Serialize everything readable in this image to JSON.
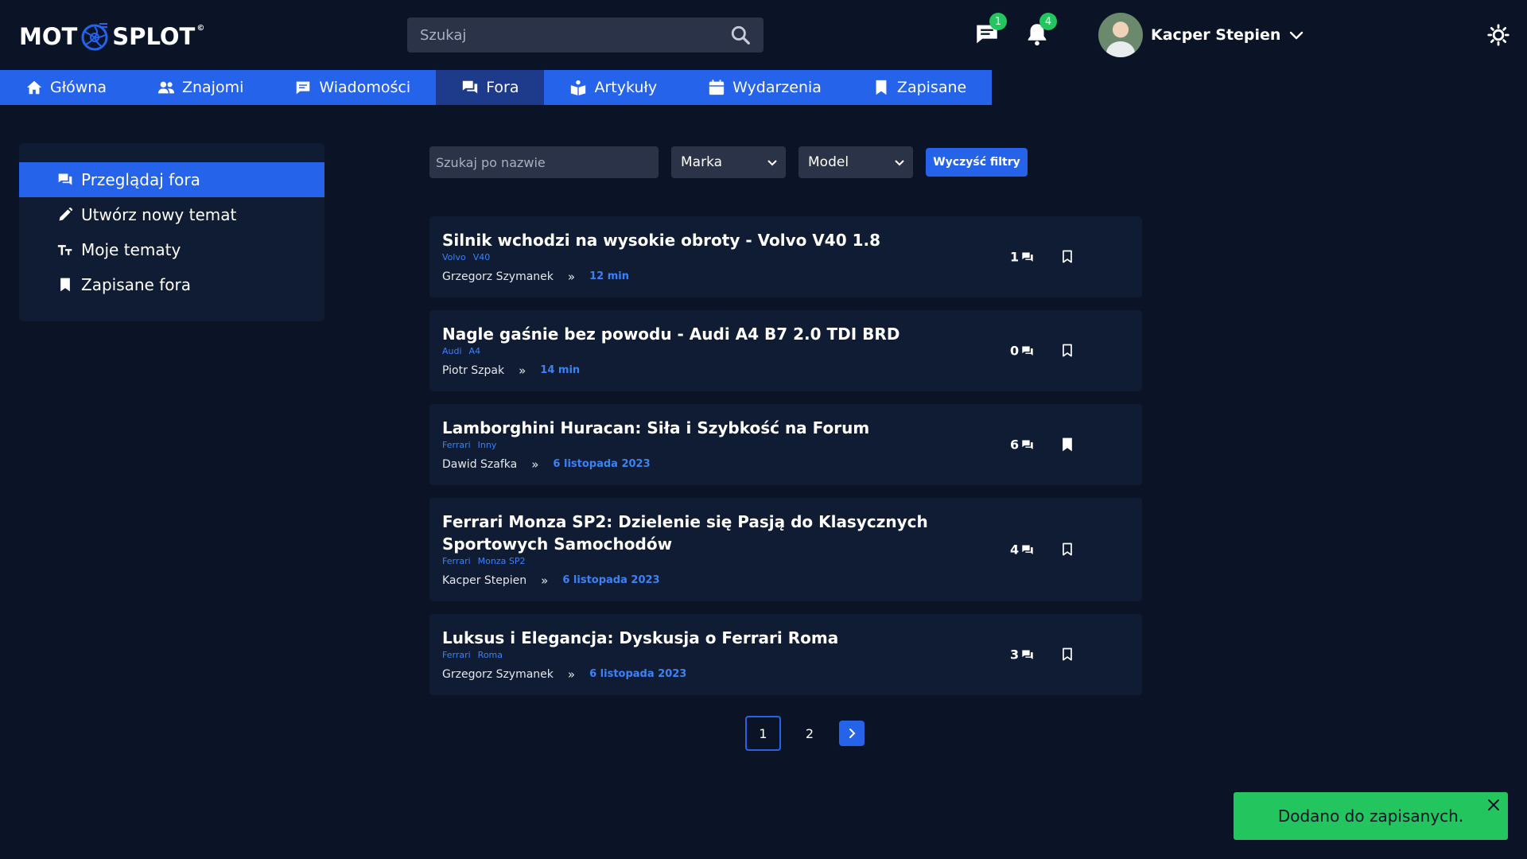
{
  "header": {
    "logo_left": "MOT",
    "logo_right": "SPLOT",
    "logo_mark": "©",
    "search_placeholder": "Szukaj",
    "messages_badge": "1",
    "notifications_badge": "4",
    "user_name": "Kacper Stepien"
  },
  "nav": {
    "items": [
      {
        "label": "Główna",
        "icon": "home-icon"
      },
      {
        "label": "Znajomi",
        "icon": "users-icon"
      },
      {
        "label": "Wiadomości",
        "icon": "message-icon"
      },
      {
        "label": "Fora",
        "icon": "forum-icon",
        "active": true
      },
      {
        "label": "Artykuły",
        "icon": "articles-icon"
      },
      {
        "label": "Wydarzenia",
        "icon": "calendar-icon"
      },
      {
        "label": "Zapisane",
        "icon": "bookmark-icon"
      }
    ]
  },
  "sidebar": {
    "items": [
      {
        "label": "Przeglądaj fora",
        "icon": "forum-icon",
        "active": true
      },
      {
        "label": "Utwórz nowy temat",
        "icon": "pencil-icon"
      },
      {
        "label": "Moje tematy",
        "icon": "text-icon"
      },
      {
        "label": "Zapisane fora",
        "icon": "bookmark-icon"
      }
    ]
  },
  "filters": {
    "name_placeholder": "Szukaj po nazwie",
    "brand": "Marka",
    "model": "Model",
    "clear_label": "Wyczyść filtry"
  },
  "topics": [
    {
      "title": "Silnik wchodzi na wysokie obroty - Volvo V40 1.8",
      "brand": "Volvo",
      "model": "V40",
      "author": "Grzegorz Szymanek",
      "time": "12 min",
      "comments": "1",
      "saved": false
    },
    {
      "title": "Nagle gaśnie bez powodu - Audi A4 B7 2.0 TDI BRD",
      "brand": "Audi",
      "model": "A4",
      "author": "Piotr Szpak",
      "time": "14 min",
      "comments": "0",
      "saved": false
    },
    {
      "title": "Lamborghini Huracan: Siła i Szybkość na Forum",
      "brand": "Ferrari",
      "model": "Inny",
      "author": "Dawid Szafka",
      "time": "6 listopada 2023",
      "comments": "6",
      "saved": true
    },
    {
      "title": "Ferrari Monza SP2: Dzielenie się Pasją do Klasycznych Sportowych Samochodów",
      "brand": "Ferrari",
      "model": "Monza SP2",
      "author": "Kacper Stepien",
      "time": "6 listopada 2023",
      "comments": "4",
      "saved": false
    },
    {
      "title": "Luksus i Elegancja: Dyskusja o Ferrari Roma",
      "brand": "Ferrari",
      "model": "Roma",
      "author": "Grzegorz Szymanek",
      "time": "6 listopada 2023",
      "comments": "3",
      "saved": false
    }
  ],
  "pagination": {
    "page1": "1",
    "page2": "2"
  },
  "toast": {
    "message": "Dodano do zapisanych."
  },
  "colors": {
    "background": "#0b1426",
    "accent": "#2563eb",
    "card": "#101c33",
    "success": "#22c55e"
  }
}
